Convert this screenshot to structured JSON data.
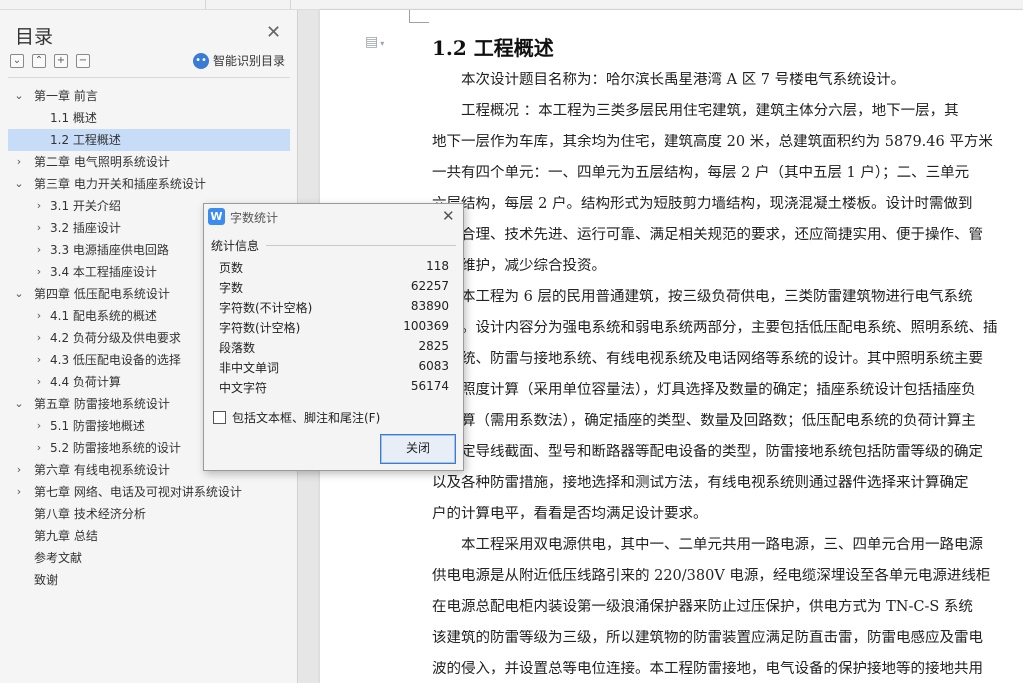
{
  "sidebar": {
    "title": "目录",
    "smart_label": "智能识别目录",
    "toc": [
      {
        "label": "第一章  前言",
        "level": 0,
        "arrow": "expanded"
      },
      {
        "label": "1.1  概述",
        "level": 1,
        "arrow": "none"
      },
      {
        "label": "1.2  工程概述",
        "level": 1,
        "arrow": "none",
        "selected": true
      },
      {
        "label": "第二章  电气照明系统设计",
        "level": 0,
        "arrow": "collapsed"
      },
      {
        "label": "第三章  电力开关和插座系统设计",
        "level": 0,
        "arrow": "expanded"
      },
      {
        "label": "3.1  开关介绍",
        "level": 1,
        "arrow": "collapsed"
      },
      {
        "label": "3.2  插座设计",
        "level": 1,
        "arrow": "collapsed"
      },
      {
        "label": "3.3  电源插座供电回路",
        "level": 1,
        "arrow": "collapsed"
      },
      {
        "label": "3.4  本工程插座设计",
        "level": 1,
        "arrow": "collapsed"
      },
      {
        "label": "第四章  低压配电系统设计",
        "level": 0,
        "arrow": "expanded"
      },
      {
        "label": "4.1  配电系统的概述",
        "level": 1,
        "arrow": "collapsed"
      },
      {
        "label": "4.2  负荷分级及供电要求",
        "level": 1,
        "arrow": "collapsed"
      },
      {
        "label": "4.3  低压配电设备的选择",
        "level": 1,
        "arrow": "collapsed"
      },
      {
        "label": "4.4  负荷计算",
        "level": 1,
        "arrow": "collapsed"
      },
      {
        "label": "第五章  防雷接地系统设计",
        "level": 0,
        "arrow": "expanded"
      },
      {
        "label": "5.1  防雷接地概述",
        "level": 1,
        "arrow": "collapsed"
      },
      {
        "label": "5.2  防雷接地系统的设计",
        "level": 1,
        "arrow": "collapsed"
      },
      {
        "label": "第六章  有线电视系统设计",
        "level": 0,
        "arrow": "collapsed"
      },
      {
        "label": "第七章  网络、电话及可视对讲系统设计",
        "level": 0,
        "arrow": "collapsed"
      },
      {
        "label": "第八章  技术经济分析",
        "level": 0,
        "arrow": "none"
      },
      {
        "label": "第九章  总结",
        "level": 0,
        "arrow": "none"
      },
      {
        "label": "参考文献",
        "level": 0,
        "arrow": "none"
      },
      {
        "label": "致谢",
        "level": 0,
        "arrow": "none"
      }
    ]
  },
  "document": {
    "heading": "1.2  工程概述",
    "lines": [
      "　　本次设计题目名称为：哈尔滨长禹星港湾 A 区 7 号楼电气系统设计。",
      "　　工程概况 ：本工程为三类多层民用住宅建筑，建筑主体分六层，地下一层，其",
      "地下一层作为车库，其余均为住宅，建筑高度 20 米，总建筑面积约为 5879.46 平方米",
      "一共有四个单元：一、四单元为五层结构，每层 2 户（其中五层 1 户）；二、三单元",
      "六层结构，每层 2 户。结构形式为短肢剪力墙结构，现浇混凝土楼板。设计时需做到",
      "经济合理、技术先进、运行可靠、满足相关规范的要求，还应简捷实用、便于操作、管",
      "理及维护，减少综合投资。",
      "　　本工程为 6 层的民用普通建筑，按三级负荷供电，三类防雷建筑物进行电气系统",
      "设计。设计内容分为强电系统和弱电系统两部分，主要包括低压配电系统、照明系统、插",
      "座系统、防雷与接地系统、有线电视系统及电话网络等系统的设计。其中照明系统主要",
      "包括照度计算（采用单位容量法），灯具选择及数量的确定；插座系统设计包括插座负",
      "荷计算（需用系数法），确定插座的类型、数量及回路数；低压配电系统的负荷计算主",
      "要确定导线截面、型号和断路器等配电设备的类型，防雷接地系统包括防雷等级的确定",
      "以及各种防雷措施，接地选择和测试方法，有线电视系统则通过器件选择来计算确定",
      "户的计算电平，看看是否均满足设计要求。",
      "　　本工程采用双电源供电，其中一、二单元共用一路电源，三、四单元合用一路电源",
      "供电电源是从附近低压线路引来的 220/380V 电源，经电缆深埋设至各单元电源进线柜",
      "在电源总配电柜内装设第一级浪涌保护器来防止过压保护，供电方式为 TN-C-S 系统",
      "该建筑的防雷等级为三级，所以建筑物的防雷装置应满足防直击雷，防雷电感应及雷电",
      "波的侵入，并设置总等电位连接。本工程防雷接地，电气设备的保护接地等的接地共用"
    ]
  },
  "dialog": {
    "icon_letter": "W",
    "title": "字数统计",
    "section": "统计信息",
    "stats": [
      {
        "label": "页数",
        "value": "118"
      },
      {
        "label": "字数",
        "value": "62257"
      },
      {
        "label": "字符数(不计空格)",
        "value": "83890"
      },
      {
        "label": "字符数(计空格)",
        "value": "100369"
      },
      {
        "label": "段落数",
        "value": "2825"
      },
      {
        "label": "非中文单词",
        "value": "6083"
      },
      {
        "label": "中文字符",
        "value": "56174"
      }
    ],
    "checkbox_label": "包括文本框、脚注和尾注(F)",
    "checkbox_checked": false,
    "close_button": "关闭"
  },
  "colors": {
    "selection": "#c7dcf6",
    "accent": "#3c8cf0"
  }
}
